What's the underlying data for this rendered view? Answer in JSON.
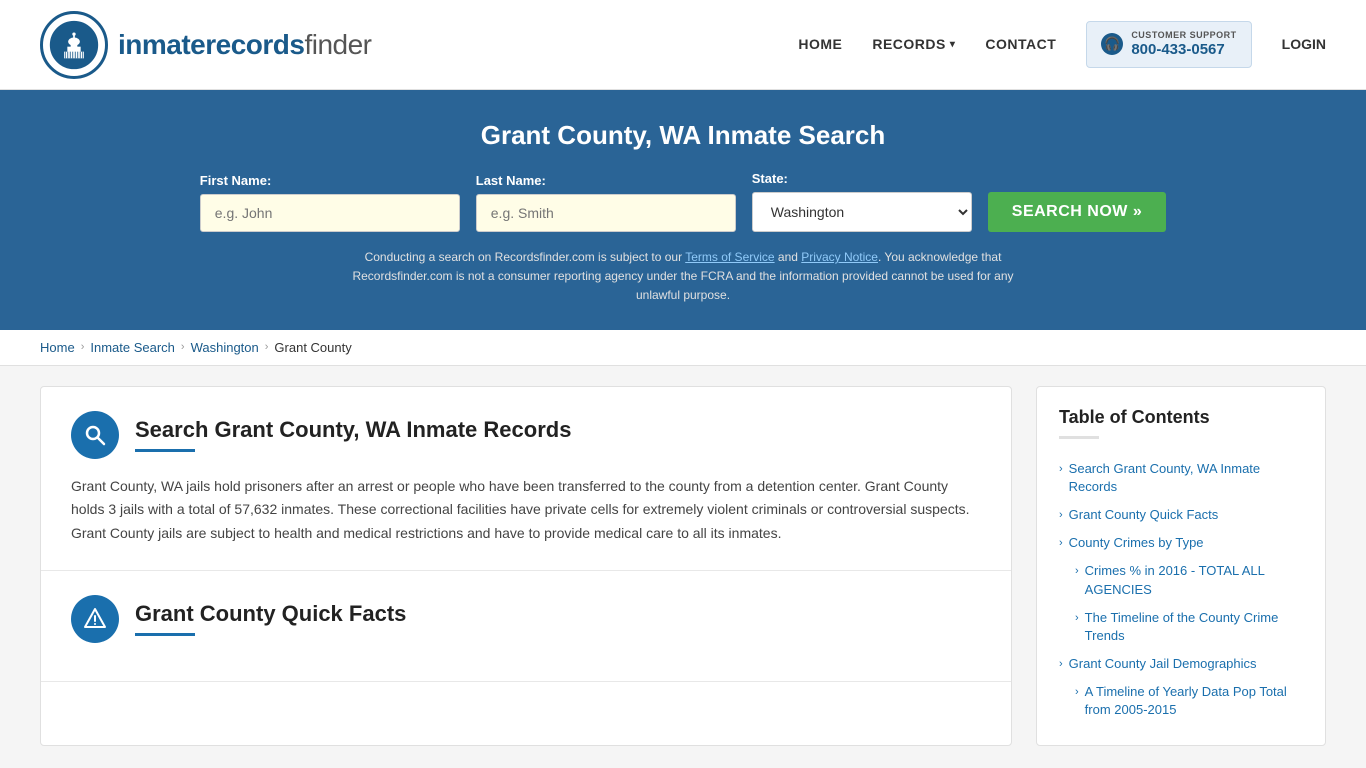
{
  "header": {
    "logo_text_main": "inmaterecords",
    "logo_text_accent": "finder",
    "nav": {
      "home": "HOME",
      "records": "RECORDS",
      "contact": "CONTACT",
      "login": "LOGIN"
    },
    "support": {
      "label": "CUSTOMER SUPPORT",
      "number": "800-433-0567"
    }
  },
  "hero": {
    "title": "Grant County, WA Inmate Search",
    "form": {
      "first_name_label": "First Name:",
      "first_name_placeholder": "e.g. John",
      "last_name_label": "Last Name:",
      "last_name_placeholder": "e.g. Smith",
      "state_label": "State:",
      "state_value": "Washington",
      "search_button": "SEARCH NOW »"
    },
    "disclaimer": "Conducting a search on Recordsfinder.com is subject to our Terms of Service and Privacy Notice. You acknowledge that Recordsfinder.com is not a consumer reporting agency under the FCRA and the information provided cannot be used for any unlawful purpose."
  },
  "breadcrumb": {
    "home": "Home",
    "inmate_search": "Inmate Search",
    "state": "Washington",
    "county": "Grant County"
  },
  "sections": [
    {
      "id": "inmate-records",
      "icon": "search",
      "title": "Search Grant County, WA Inmate Records",
      "text": "Grant County, WA jails hold prisoners after an arrest or people who have been transferred to the county from a detention center. Grant County holds 3 jails with a total of 57,632 inmates. These correctional facilities have private cells for extremely violent criminals or controversial suspects. Grant County jails are subject to health and medical restrictions and have to provide medical care to all its inmates."
    },
    {
      "id": "quick-facts",
      "icon": "alert",
      "title": "Grant County Quick Facts",
      "text": ""
    }
  ],
  "toc": {
    "title": "Table of Contents",
    "items": [
      {
        "label": "Search Grant County, WA Inmate Records",
        "sub": false
      },
      {
        "label": "Grant County Quick Facts",
        "sub": false
      },
      {
        "label": "County Crimes by Type",
        "sub": false
      },
      {
        "label": "Crimes % in 2016 - TOTAL ALL AGENCIES",
        "sub": true
      },
      {
        "label": "The Timeline of the County Crime Trends",
        "sub": true
      },
      {
        "label": "Grant County Jail Demographics",
        "sub": false
      },
      {
        "label": "A Timeline of Yearly Data Pop Total from 2005-2015",
        "sub": true
      }
    ]
  }
}
